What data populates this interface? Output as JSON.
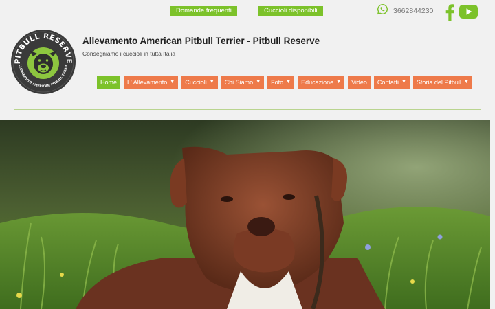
{
  "topbar": {
    "faq_label": "Domande frequenti",
    "puppies_label": "Cuccioli disponibili",
    "phone": "3662844230"
  },
  "header": {
    "logo_text_top": "PITBULL RESERVE",
    "logo_text_bottom": "ALLEVAMENTO AMERICAN PITBULL TERRIER",
    "title": "Allevamento American Pitbull Terrier - Pitbull Reserve",
    "subtitle": "Consegniamo i cuccioli in tutta Italia"
  },
  "nav": {
    "items": [
      {
        "label": "Home"
      },
      {
        "label": "L' Allevamento"
      },
      {
        "label": "Cuccioli"
      },
      {
        "label": "Chi Siamo"
      },
      {
        "label": "Foto"
      },
      {
        "label": "Educazione"
      },
      {
        "label": "Video"
      },
      {
        "label": "Contatti"
      },
      {
        "label": "Storia del Pitbull"
      }
    ]
  },
  "icons": {
    "whatsapp": "whatsapp-icon",
    "facebook": "facebook-icon",
    "youtube": "youtube-icon",
    "dropdown": "chevron-down-icon"
  },
  "colors": {
    "accent_green": "#7cc22a",
    "menu_orange": "#ee7a4a",
    "background": "#f1f1f1"
  }
}
